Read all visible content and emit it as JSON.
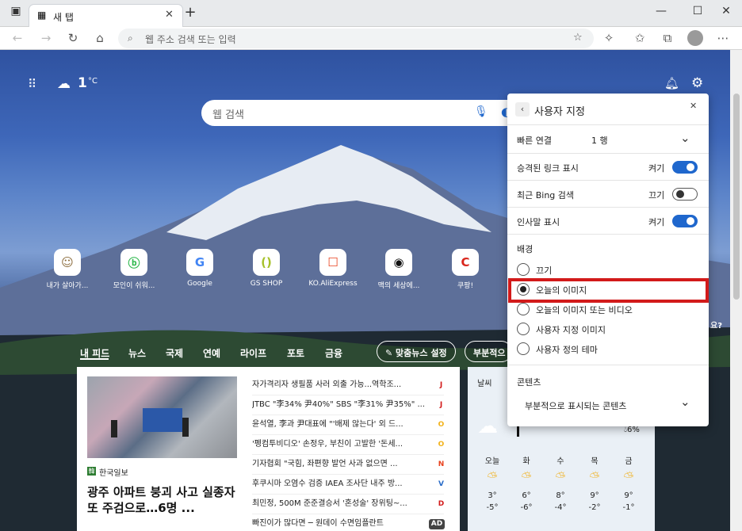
{
  "browser": {
    "tab_title": "새 탭",
    "new_tab_symbol": "+",
    "address_placeholder": "웹 주소 검색 또는 입력"
  },
  "page": {
    "temperature": "1",
    "temp_unit": "°C",
    "search_placeholder": "웹 검색",
    "quick_links": [
      {
        "label": "내가 살아가...",
        "icon": "person-photo-icon",
        "glyph": "☺",
        "color": "#8a6a3a"
      },
      {
        "label": "모인이 쉬워...",
        "icon": "green-logo-icon",
        "glyph": "ⓑ",
        "color": "#2db84c"
      },
      {
        "label": "Google",
        "icon": "google-icon",
        "glyph": "G",
        "color": "#4285f4"
      },
      {
        "label": "GS SHOP",
        "icon": "gs-shop-icon",
        "glyph": "()",
        "color": "#a6c12a"
      },
      {
        "label": "KO.AliExpress",
        "icon": "aliexpress-icon",
        "glyph": "☐",
        "color": "#e8411d"
      },
      {
        "label": "맥의 세상에...",
        "icon": "apple-icon",
        "glyph": "◉",
        "color": "#111111"
      },
      {
        "label": "쿠팡!",
        "icon": "coupang-icon",
        "glyph": "C",
        "color": "#d9261c"
      }
    ],
    "feed_tabs": [
      "내 피드",
      "뉴스",
      "국제",
      "연예",
      "라이프",
      "포토",
      "금융"
    ],
    "personalize_button": "맞춤뉴스 설정",
    "partial_button": "부분적으",
    "featured": {
      "source": "한국일보",
      "headline": "광주 아파트 붕괴 사고 실종자 또 주검으로…6명 ..."
    },
    "headlines": [
      {
        "text": "자가격리자 생필품 사러 외출 가능...역학조...",
        "badge": "J",
        "badge_color": "#d21a1a"
      },
      {
        "text": "JTBC \"李34% 尹40%\" SBS \"李31% 尹35%\" ...",
        "badge": "J",
        "badge_color": "#d21a1a"
      },
      {
        "text": "윤석열, 李과 尹대표에 \"'배제 않는다' 외 드...",
        "badge": "O",
        "badge_color": "#f2b21a"
      },
      {
        "text": "'펭컴투비디오' 손정우, 부친이 고발한 '돈세...",
        "badge": "O",
        "badge_color": "#f2b21a"
      },
      {
        "text": "기자협회 \"국힘, 좌편향 발언 사과 없으면 ...",
        "badge": "N",
        "badge_color": "#e8411d"
      },
      {
        "text": "후쿠시마 오염수 검증 IAEA 조사단 내주 방...",
        "badge": "V",
        "badge_color": "#2a6cc8"
      },
      {
        "text": "최민정, 500M 준준결승서 '혼성술' 장위팅~...",
        "badge": "D",
        "badge_color": "#d21a1a"
      },
      {
        "text": "빠진이가 많다면 ─ 원데이 수면임플란트",
        "badge": "AD",
        "badge_color": "#444444"
      }
    ],
    "weather": {
      "label": "날씨",
      "humidity": "6%",
      "days": [
        {
          "day": "오늘",
          "high": "3°",
          "low": "-5°"
        },
        {
          "day": "화",
          "high": "6°",
          "low": "-6°"
        },
        {
          "day": "수",
          "high": "8°",
          "low": "-4°"
        },
        {
          "day": "목",
          "high": "9°",
          "low": "-2°"
        },
        {
          "day": "금",
          "high": "9°",
          "low": "-1°"
        }
      ]
    },
    "side_fragment": "요?"
  },
  "panel": {
    "title": "사용자 지정",
    "quick_links_label": "빠른 연결",
    "quick_links_value": "1 행",
    "toggles": [
      {
        "label": "승격된 링크 표시",
        "state": "켜기",
        "on": true
      },
      {
        "label": "최근 Bing 검색",
        "state": "끄기",
        "on": false
      },
      {
        "label": "인사말 표시",
        "state": "켜기",
        "on": true
      }
    ],
    "background_label": "배경",
    "background_options": [
      {
        "label": "끄기",
        "selected": false
      },
      {
        "label": "오늘의 이미지",
        "selected": true
      },
      {
        "label": "오늘의 이미지 또는 비디오",
        "selected": false
      },
      {
        "label": "사용자 지정 이미지",
        "selected": false
      },
      {
        "label": "사용자 정의 테마",
        "selected": false
      }
    ],
    "content_label": "콘텐츠",
    "content_value": "부분적으로 표시되는 콘텐츠"
  }
}
